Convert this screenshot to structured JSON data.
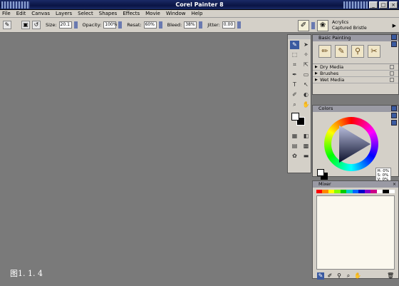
{
  "window": {
    "title": "Corel Painter 8",
    "controls": [
      "_",
      "□",
      "×"
    ]
  },
  "menu": [
    "File",
    "Edit",
    "Canvas",
    "Layers",
    "Select",
    "Shapes",
    "Effects",
    "Movie",
    "Window",
    "Help"
  ],
  "property_bar": {
    "size_label": "Size:",
    "size_value": "20.1",
    "opacity_label": "Opacity:",
    "opacity_value": "100%",
    "resat_label": "Resat:",
    "resat_value": "60%",
    "bleed_label": "Bleed:",
    "bleed_value": "38%",
    "jitter_label": "Jitter:",
    "jitter_value": "0.00"
  },
  "brush_selector": {
    "category": "Acrylics",
    "variant": "Captured Bristle"
  },
  "toolbox": {
    "tools": [
      "brush-tool",
      "selection-arrow",
      "rect-select",
      "magic-wand",
      "crop-tool",
      "lasso-select",
      "pen-tool",
      "rectangle-shape",
      "text-tool",
      "shape-select",
      "dropper-tool",
      "paint-bucket",
      "magnifier",
      "grabber-hand",
      "divine-proportion",
      "layout-grid"
    ]
  },
  "panels": {
    "brushes": {
      "title": "Basic Painting",
      "icons": [
        "pencil-brush",
        "oil-brush",
        "palette-knife",
        "eraser-brush"
      ],
      "drawers": [
        "Dry Media",
        "Brushes",
        "Wet Media"
      ]
    },
    "colors": {
      "title": "Colors",
      "hsv": [
        "H: 0%",
        "S: 0%",
        "V: 0%"
      ]
    },
    "mixer": {
      "title": "Mixer",
      "palette": [
        "#ff0000",
        "#ff8800",
        "#ffff00",
        "#88ff00",
        "#00cc00",
        "#00cccc",
        "#0066ff",
        "#0000cc",
        "#8800cc",
        "#cc0088",
        "#ffffff",
        "#000000",
        "#ffffff"
      ]
    }
  },
  "caption": "图1. 1. 4"
}
